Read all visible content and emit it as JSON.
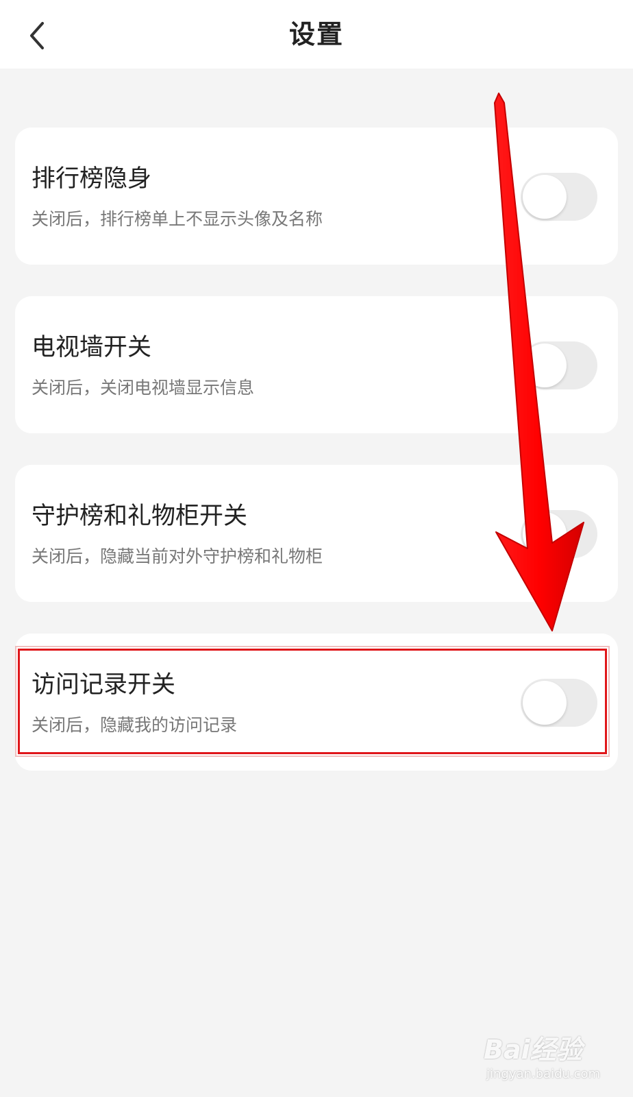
{
  "header": {
    "back_icon": "chevron-left-icon",
    "title": "设置"
  },
  "settings": [
    {
      "title": "排行榜隐身",
      "description": "关闭后，排行榜单上不显示头像及名称",
      "enabled": false
    },
    {
      "title": "电视墙开关",
      "description": "关闭后，关闭电视墙显示信息",
      "enabled": false
    },
    {
      "title": "守护榜和礼物柜开关",
      "description": "关闭后，隐藏当前对外守护榜和礼物柜",
      "enabled": false
    },
    {
      "title": "访问记录开关",
      "description": "关闭后，隐藏我的访问记录",
      "enabled": false
    }
  ],
  "annotation": {
    "arrow_color": "#ff0000",
    "highlight_color": "#e0161a"
  },
  "watermark": {
    "brand": "Bai经验",
    "url": "jingyan.baidu.com"
  },
  "colors": {
    "background": "#f4f4f4",
    "card": "#ffffff",
    "toggle_off": "#ebebeb"
  }
}
